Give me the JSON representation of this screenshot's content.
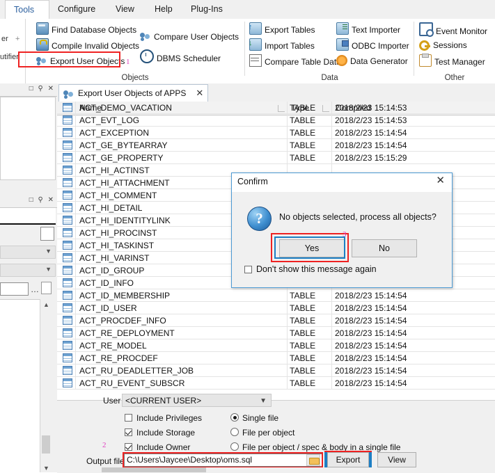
{
  "menubar": {
    "items": [
      {
        "label": "Tools",
        "active": true
      },
      {
        "label": "Configure",
        "active": false
      },
      {
        "label": "View",
        "active": false
      },
      {
        "label": "Help",
        "active": false
      },
      {
        "label": "Plug-Ins",
        "active": false
      }
    ]
  },
  "ribbon": {
    "left_strip": {
      "line1": "er",
      "line1_extra": "+",
      "line2": "utifier"
    },
    "groups": [
      {
        "label": "Objects",
        "items": [
          {
            "label": "Find Database Objects",
            "icon": "database-search-icon",
            "accel_index": 0
          },
          {
            "label": "Compile Invalid Objects",
            "icon": "compile-lock-icon",
            "accel_index": 8
          },
          {
            "label": "Export User Objects",
            "icon": "export-users-icon",
            "accel_index": 7,
            "highlighted": true
          },
          {
            "label": "Compare User Objects",
            "icon": "compare-users-icon",
            "accel_index": 8
          },
          {
            "label": "DBMS Scheduler",
            "icon": "clock-icon",
            "accel_index": 0
          }
        ]
      },
      {
        "label": "Data",
        "items": [
          {
            "label": "Export Tables",
            "icon": "export-table-icon",
            "accel_index": 1
          },
          {
            "label": "Import Tables",
            "icon": "import-table-icon",
            "accel_index": 12
          },
          {
            "label": "Compare Table Data",
            "icon": "compare-data-icon",
            "accel_index": 0
          },
          {
            "label": "Text Importer",
            "icon": "text-import-icon",
            "accel_index": 5
          },
          {
            "label": "ODBC Importer",
            "icon": "odbc-import-icon",
            "accel_index": 5
          },
          {
            "label": "Data Generator",
            "icon": "data-generator-icon",
            "accel_index": 5
          }
        ]
      },
      {
        "label": "Other",
        "items": [
          {
            "label": "Event Monitor",
            "icon": "event-monitor-icon",
            "accel_index": 1
          },
          {
            "label": "Sessions",
            "icon": "sessions-key-icon",
            "accel_index": 0
          },
          {
            "label": "Test Manager",
            "icon": "test-manager-icon",
            "accel_index": 5
          }
        ]
      }
    ]
  },
  "left_panels": {
    "header_buttons": "□ ⚲ ✕",
    "panels": [
      {
        "name": "panel-top"
      },
      {
        "name": "panel-middle"
      },
      {
        "name": "panel-bottom"
      }
    ],
    "dots_button": "…"
  },
  "document_tab": {
    "title": "Export User Objects of APPS",
    "icon": "export-users-icon",
    "close": "✕"
  },
  "grid": {
    "columns": [
      "Name",
      "Type",
      "Compiled"
    ],
    "rows": [
      {
        "name": "ACT_DEMO_VACATION",
        "type": "TABLE",
        "compiled": "2018/2/23 15:14:53"
      },
      {
        "name": "ACT_EVT_LOG",
        "type": "TABLE",
        "compiled": "2018/2/23 15:14:53"
      },
      {
        "name": "ACT_EXCEPTION",
        "type": "TABLE",
        "compiled": "2018/2/23 15:14:54"
      },
      {
        "name": "ACT_GE_BYTEARRAY",
        "type": "TABLE",
        "compiled": "2018/2/23 15:14:54"
      },
      {
        "name": "ACT_GE_PROPERTY",
        "type": "TABLE",
        "compiled": "2018/2/23 15:15:29"
      },
      {
        "name": "ACT_HI_ACTINST",
        "type": "",
        "compiled": ""
      },
      {
        "name": "ACT_HI_ATTACHMENT",
        "type": "",
        "compiled": ""
      },
      {
        "name": "ACT_HI_COMMENT",
        "type": "",
        "compiled": ""
      },
      {
        "name": "ACT_HI_DETAIL",
        "type": "",
        "compiled": ""
      },
      {
        "name": "ACT_HI_IDENTITYLINK",
        "type": "",
        "compiled": ""
      },
      {
        "name": "ACT_HI_PROCINST",
        "type": "",
        "compiled": ""
      },
      {
        "name": "ACT_HI_TASKINST",
        "type": "",
        "compiled": ""
      },
      {
        "name": "ACT_HI_VARINST",
        "type": "",
        "compiled": ""
      },
      {
        "name": "ACT_ID_GROUP",
        "type": "",
        "compiled": ""
      },
      {
        "name": "ACT_ID_INFO",
        "type": "",
        "compiled": ""
      },
      {
        "name": "ACT_ID_MEMBERSHIP",
        "type": "TABLE",
        "compiled": "2018/2/23 15:14:54"
      },
      {
        "name": "ACT_ID_USER",
        "type": "TABLE",
        "compiled": "2018/2/23 15:14:54"
      },
      {
        "name": "ACT_PROCDEF_INFO",
        "type": "TABLE",
        "compiled": "2018/2/23 15:14:54"
      },
      {
        "name": "ACT_RE_DEPLOYMENT",
        "type": "TABLE",
        "compiled": "2018/2/23 15:14:54"
      },
      {
        "name": "ACT_RE_MODEL",
        "type": "TABLE",
        "compiled": "2018/2/23 15:14:54"
      },
      {
        "name": "ACT_RE_PROCDEF",
        "type": "TABLE",
        "compiled": "2018/2/23 15:14:54"
      },
      {
        "name": "ACT_RU_DEADLETTER_JOB",
        "type": "TABLE",
        "compiled": "2018/2/23 15:14:54"
      },
      {
        "name": "ACT_RU_EVENT_SUBSCR",
        "type": "TABLE",
        "compiled": "2018/2/23 15:14:54"
      }
    ]
  },
  "options": {
    "user_label": "User",
    "user_value": "<CURRENT USER>",
    "checkboxes": [
      {
        "label": "Include Privileges",
        "checked": false
      },
      {
        "label": "Include Storage",
        "checked": true
      },
      {
        "label": "Include Owner",
        "checked": true
      }
    ],
    "radios": [
      {
        "label": "Single file",
        "selected": true
      },
      {
        "label": "File per object",
        "selected": false
      },
      {
        "label": "File per object / spec & body in a single file",
        "selected": false
      }
    ],
    "output_label": "Output file",
    "output_value": "C:\\Users\\Jaycee\\Desktop\\oms.sql",
    "browse_icon": "folder-icon",
    "export_button": "Export",
    "view_button": "View"
  },
  "dialog": {
    "title": "Confirm",
    "close": "✕",
    "icon": "question-icon",
    "message": "No objects selected, process all objects?",
    "yes_button": "Yes",
    "no_button": "No",
    "dont_show_label": "Don't show this message again",
    "dont_show_checked": false
  },
  "annotations": [
    {
      "number": "1"
    },
    {
      "number": "2"
    },
    {
      "number": "3"
    }
  ],
  "colors": {
    "accent": "#1d7fc4",
    "highlight": "#ee2222",
    "annotation": "#e040c0",
    "menu_active": "#2b5f9e"
  }
}
